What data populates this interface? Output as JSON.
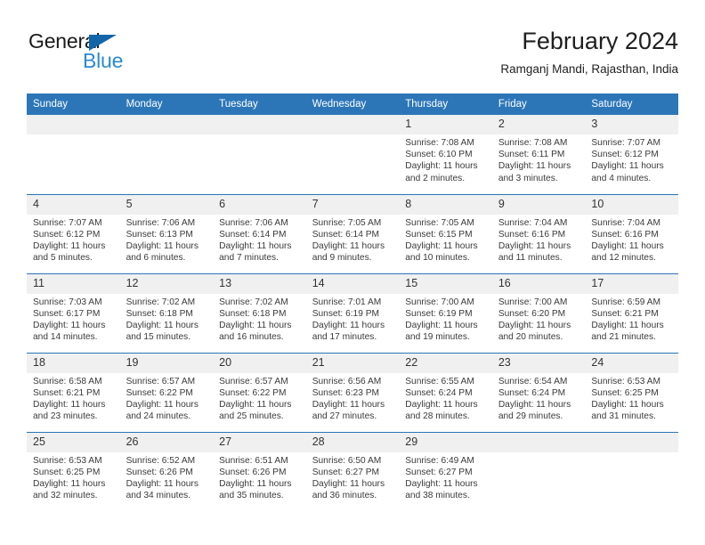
{
  "brand": {
    "line1": "General",
    "line2": "Blue",
    "triangle_color": "#1265a8",
    "line2_color": "#2b8ad0",
    "icon": "general-blue-logo"
  },
  "header": {
    "title": "February 2024",
    "subtitle": "Ramganj Mandi, Rajasthan, India"
  },
  "theme": {
    "header_bg": "#2c76b8",
    "daynum_bg": "#f0f0f0",
    "text": "#333333"
  },
  "weekday_headers": [
    "Sunday",
    "Monday",
    "Tuesday",
    "Wednesday",
    "Thursday",
    "Friday",
    "Saturday"
  ],
  "weeks": [
    [
      {
        "day": "",
        "blank": true
      },
      {
        "day": "",
        "blank": true
      },
      {
        "day": "",
        "blank": true
      },
      {
        "day": "",
        "blank": true
      },
      {
        "day": "1",
        "sunrise": "Sunrise: 7:08 AM",
        "sunset": "Sunset: 6:10 PM",
        "daylight1": "Daylight: 11 hours",
        "daylight2": "and 2 minutes."
      },
      {
        "day": "2",
        "sunrise": "Sunrise: 7:08 AM",
        "sunset": "Sunset: 6:11 PM",
        "daylight1": "Daylight: 11 hours",
        "daylight2": "and 3 minutes."
      },
      {
        "day": "3",
        "sunrise": "Sunrise: 7:07 AM",
        "sunset": "Sunset: 6:12 PM",
        "daylight1": "Daylight: 11 hours",
        "daylight2": "and 4 minutes."
      }
    ],
    [
      {
        "day": "4",
        "sunrise": "Sunrise: 7:07 AM",
        "sunset": "Sunset: 6:12 PM",
        "daylight1": "Daylight: 11 hours",
        "daylight2": "and 5 minutes."
      },
      {
        "day": "5",
        "sunrise": "Sunrise: 7:06 AM",
        "sunset": "Sunset: 6:13 PM",
        "daylight1": "Daylight: 11 hours",
        "daylight2": "and 6 minutes."
      },
      {
        "day": "6",
        "sunrise": "Sunrise: 7:06 AM",
        "sunset": "Sunset: 6:14 PM",
        "daylight1": "Daylight: 11 hours",
        "daylight2": "and 7 minutes."
      },
      {
        "day": "7",
        "sunrise": "Sunrise: 7:05 AM",
        "sunset": "Sunset: 6:14 PM",
        "daylight1": "Daylight: 11 hours",
        "daylight2": "and 9 minutes."
      },
      {
        "day": "8",
        "sunrise": "Sunrise: 7:05 AM",
        "sunset": "Sunset: 6:15 PM",
        "daylight1": "Daylight: 11 hours",
        "daylight2": "and 10 minutes."
      },
      {
        "day": "9",
        "sunrise": "Sunrise: 7:04 AM",
        "sunset": "Sunset: 6:16 PM",
        "daylight1": "Daylight: 11 hours",
        "daylight2": "and 11 minutes."
      },
      {
        "day": "10",
        "sunrise": "Sunrise: 7:04 AM",
        "sunset": "Sunset: 6:16 PM",
        "daylight1": "Daylight: 11 hours",
        "daylight2": "and 12 minutes."
      }
    ],
    [
      {
        "day": "11",
        "sunrise": "Sunrise: 7:03 AM",
        "sunset": "Sunset: 6:17 PM",
        "daylight1": "Daylight: 11 hours",
        "daylight2": "and 14 minutes."
      },
      {
        "day": "12",
        "sunrise": "Sunrise: 7:02 AM",
        "sunset": "Sunset: 6:18 PM",
        "daylight1": "Daylight: 11 hours",
        "daylight2": "and 15 minutes."
      },
      {
        "day": "13",
        "sunrise": "Sunrise: 7:02 AM",
        "sunset": "Sunset: 6:18 PM",
        "daylight1": "Daylight: 11 hours",
        "daylight2": "and 16 minutes."
      },
      {
        "day": "14",
        "sunrise": "Sunrise: 7:01 AM",
        "sunset": "Sunset: 6:19 PM",
        "daylight1": "Daylight: 11 hours",
        "daylight2": "and 17 minutes."
      },
      {
        "day": "15",
        "sunrise": "Sunrise: 7:00 AM",
        "sunset": "Sunset: 6:19 PM",
        "daylight1": "Daylight: 11 hours",
        "daylight2": "and 19 minutes."
      },
      {
        "day": "16",
        "sunrise": "Sunrise: 7:00 AM",
        "sunset": "Sunset: 6:20 PM",
        "daylight1": "Daylight: 11 hours",
        "daylight2": "and 20 minutes."
      },
      {
        "day": "17",
        "sunrise": "Sunrise: 6:59 AM",
        "sunset": "Sunset: 6:21 PM",
        "daylight1": "Daylight: 11 hours",
        "daylight2": "and 21 minutes."
      }
    ],
    [
      {
        "day": "18",
        "sunrise": "Sunrise: 6:58 AM",
        "sunset": "Sunset: 6:21 PM",
        "daylight1": "Daylight: 11 hours",
        "daylight2": "and 23 minutes."
      },
      {
        "day": "19",
        "sunrise": "Sunrise: 6:57 AM",
        "sunset": "Sunset: 6:22 PM",
        "daylight1": "Daylight: 11 hours",
        "daylight2": "and 24 minutes."
      },
      {
        "day": "20",
        "sunrise": "Sunrise: 6:57 AM",
        "sunset": "Sunset: 6:22 PM",
        "daylight1": "Daylight: 11 hours",
        "daylight2": "and 25 minutes."
      },
      {
        "day": "21",
        "sunrise": "Sunrise: 6:56 AM",
        "sunset": "Sunset: 6:23 PM",
        "daylight1": "Daylight: 11 hours",
        "daylight2": "and 27 minutes."
      },
      {
        "day": "22",
        "sunrise": "Sunrise: 6:55 AM",
        "sunset": "Sunset: 6:24 PM",
        "daylight1": "Daylight: 11 hours",
        "daylight2": "and 28 minutes."
      },
      {
        "day": "23",
        "sunrise": "Sunrise: 6:54 AM",
        "sunset": "Sunset: 6:24 PM",
        "daylight1": "Daylight: 11 hours",
        "daylight2": "and 29 minutes."
      },
      {
        "day": "24",
        "sunrise": "Sunrise: 6:53 AM",
        "sunset": "Sunset: 6:25 PM",
        "daylight1": "Daylight: 11 hours",
        "daylight2": "and 31 minutes."
      }
    ],
    [
      {
        "day": "25",
        "sunrise": "Sunrise: 6:53 AM",
        "sunset": "Sunset: 6:25 PM",
        "daylight1": "Daylight: 11 hours",
        "daylight2": "and 32 minutes."
      },
      {
        "day": "26",
        "sunrise": "Sunrise: 6:52 AM",
        "sunset": "Sunset: 6:26 PM",
        "daylight1": "Daylight: 11 hours",
        "daylight2": "and 34 minutes."
      },
      {
        "day": "27",
        "sunrise": "Sunrise: 6:51 AM",
        "sunset": "Sunset: 6:26 PM",
        "daylight1": "Daylight: 11 hours",
        "daylight2": "and 35 minutes."
      },
      {
        "day": "28",
        "sunrise": "Sunrise: 6:50 AM",
        "sunset": "Sunset: 6:27 PM",
        "daylight1": "Daylight: 11 hours",
        "daylight2": "and 36 minutes."
      },
      {
        "day": "29",
        "sunrise": "Sunrise: 6:49 AM",
        "sunset": "Sunset: 6:27 PM",
        "daylight1": "Daylight: 11 hours",
        "daylight2": "and 38 minutes."
      },
      {
        "day": "",
        "blank": true
      },
      {
        "day": "",
        "blank": true
      }
    ]
  ]
}
